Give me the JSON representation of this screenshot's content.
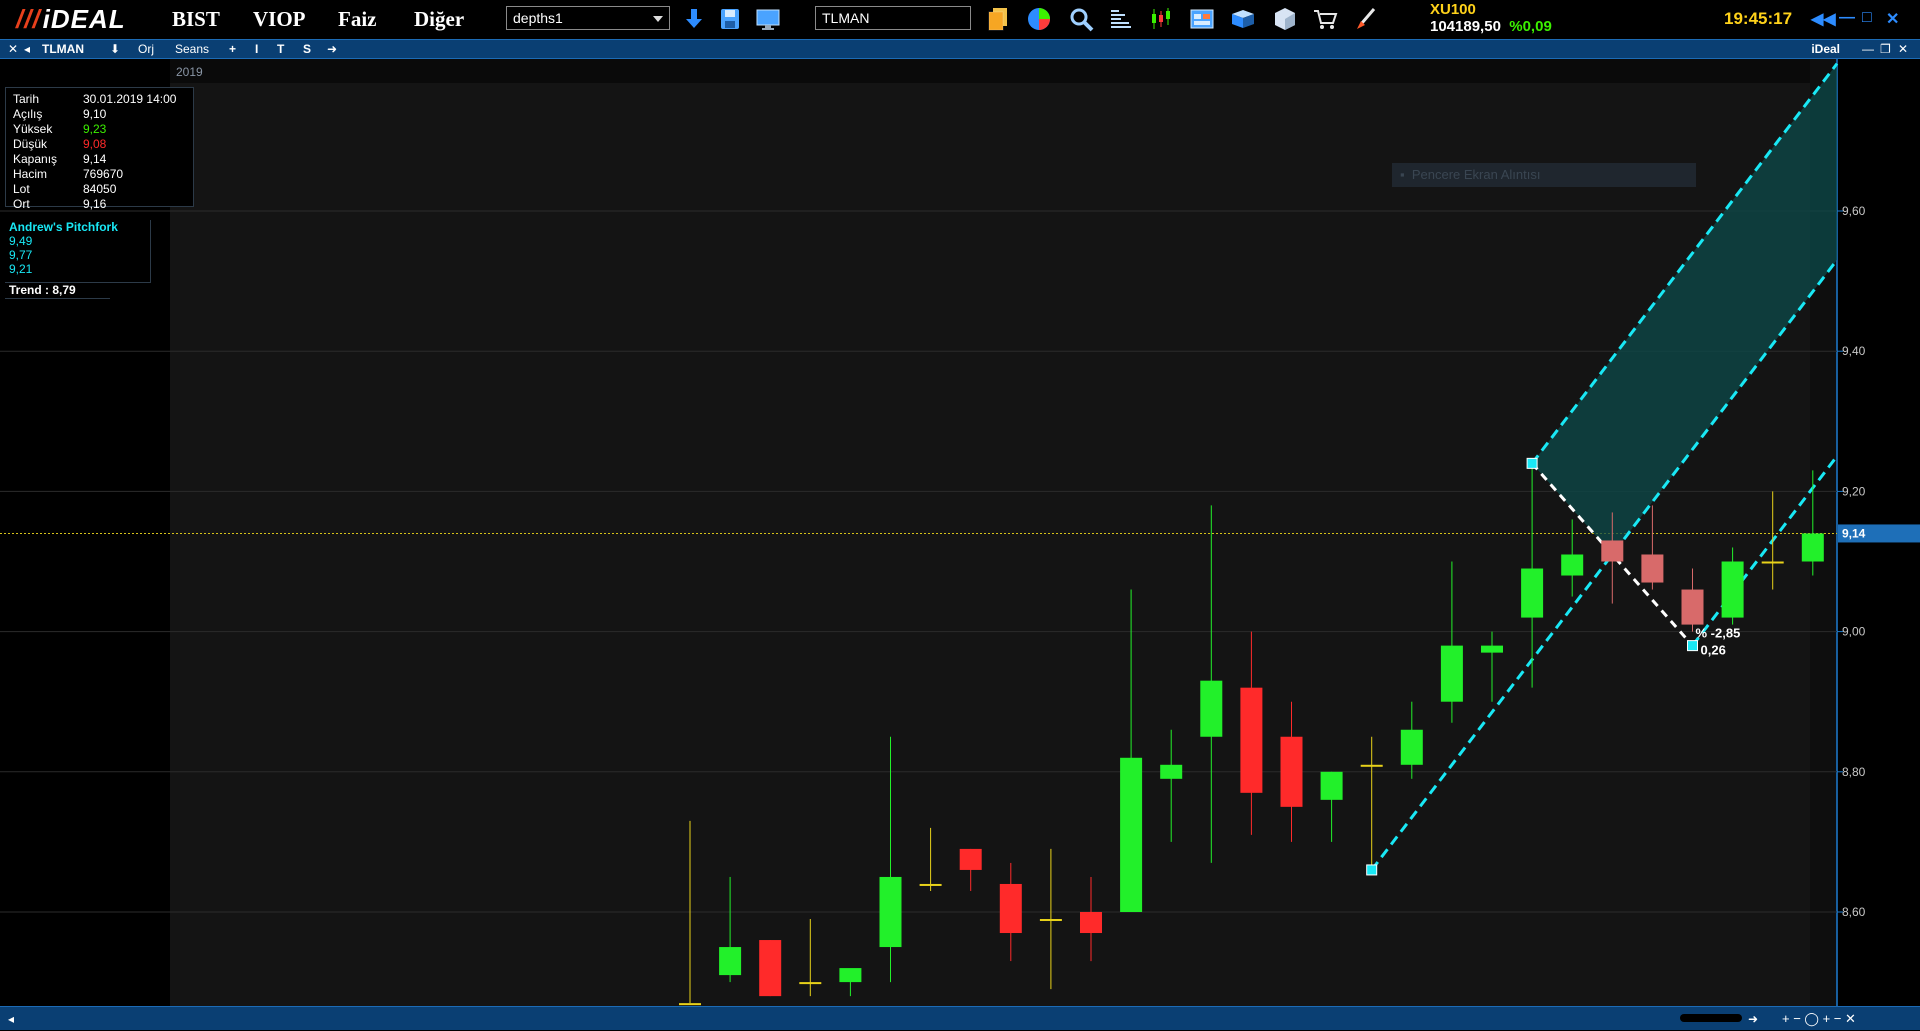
{
  "app": {
    "logo": "iDEAL",
    "menu": [
      "BIST",
      "VIOP",
      "Faiz",
      "Diğer"
    ],
    "layout_combo": "depths1",
    "symbol_input": "TLMAN"
  },
  "ticker": {
    "name": "XU100",
    "value": "104189,50",
    "change": "%0,09"
  },
  "clock": "19:45:17",
  "chart_toolbar": {
    "symbol": "TLMAN",
    "buttons": [
      "Orj",
      "Seans",
      "+",
      "I",
      "T",
      "S"
    ],
    "brand": "iDeal"
  },
  "chart_header": {
    "year_label": "2019"
  },
  "info_panel": {
    "rows": [
      {
        "k": "Tarih",
        "v": "30.01.2019 14:00"
      },
      {
        "k": "Açılış",
        "v": "9,10"
      },
      {
        "k": "Yüksek",
        "v": "9,23"
      },
      {
        "k": "Düşük",
        "v": "9,08"
      },
      {
        "k": "Kapanış",
        "v": "9,14"
      },
      {
        "k": "Hacim",
        "v": "769670"
      },
      {
        "k": "Lot",
        "v": "84050"
      },
      {
        "k": "Ort",
        "v": "9,16"
      }
    ],
    "colors": {
      "Yüksek": "#3cf000",
      "Düşük": "#ff2a2a"
    }
  },
  "pitchfork": {
    "title": "Andrew's Pitchfork",
    "values": [
      "9,49",
      "9,77",
      "9,21"
    ]
  },
  "trend": "Trend  :  8,79",
  "popup_text": "Pencere Ekran Alıntısı",
  "annotations": {
    "pct": "% -2,85",
    "diff": "0,26"
  },
  "price_axis": {
    "current": "9,14"
  },
  "chart_data": {
    "type": "candlestick",
    "ylim": [
      8.47,
      9.78
    ],
    "y_ticks": [
      8.6,
      8.8,
      9.0,
      9.2,
      9.4,
      9.6
    ],
    "y_tick_labels": [
      "8,60",
      "8,80",
      "9,00",
      "9,20",
      "9,40",
      "9,60"
    ],
    "current_price": 9.14,
    "candles": [
      {
        "o": 8.47,
        "h": 8.73,
        "l": 8.47,
        "c": 8.47
      },
      {
        "o": 8.51,
        "h": 8.65,
        "l": 8.5,
        "c": 8.55
      },
      {
        "o": 8.56,
        "h": 8.56,
        "l": 8.48,
        "c": 8.48
      },
      {
        "o": 8.5,
        "h": 8.59,
        "l": 8.48,
        "c": 8.5
      },
      {
        "o": 8.5,
        "h": 8.51,
        "l": 8.48,
        "c": 8.52
      },
      {
        "o": 8.55,
        "h": 8.85,
        "l": 8.5,
        "c": 8.65
      },
      {
        "o": 8.64,
        "h": 8.72,
        "l": 8.63,
        "c": 8.64
      },
      {
        "o": 8.69,
        "h": 8.69,
        "l": 8.63,
        "c": 8.66
      },
      {
        "o": 8.64,
        "h": 8.67,
        "l": 8.53,
        "c": 8.57
      },
      {
        "o": 8.59,
        "h": 8.69,
        "l": 8.49,
        "c": 8.59
      },
      {
        "o": 8.6,
        "h": 8.65,
        "l": 8.53,
        "c": 8.57
      },
      {
        "o": 8.6,
        "h": 9.06,
        "l": 8.6,
        "c": 8.82
      },
      {
        "o": 8.79,
        "h": 8.86,
        "l": 8.7,
        "c": 8.81
      },
      {
        "o": 8.85,
        "h": 9.18,
        "l": 8.67,
        "c": 8.93
      },
      {
        "o": 8.92,
        "h": 9.0,
        "l": 8.71,
        "c": 8.77
      },
      {
        "o": 8.85,
        "h": 8.9,
        "l": 8.7,
        "c": 8.75
      },
      {
        "o": 8.76,
        "h": 8.8,
        "l": 8.7,
        "c": 8.8
      },
      {
        "o": 8.81,
        "h": 8.85,
        "l": 8.66,
        "c": 8.81
      },
      {
        "o": 8.81,
        "h": 8.9,
        "l": 8.79,
        "c": 8.86
      },
      {
        "o": 8.9,
        "h": 9.1,
        "l": 8.87,
        "c": 8.98
      },
      {
        "o": 8.97,
        "h": 9.0,
        "l": 8.9,
        "c": 8.98
      },
      {
        "o": 9.02,
        "h": 9.24,
        "l": 8.92,
        "c": 9.09
      },
      {
        "o": 9.08,
        "h": 9.16,
        "l": 9.05,
        "c": 9.11
      },
      {
        "o": 9.13,
        "h": 9.17,
        "l": 9.04,
        "c": 9.1
      },
      {
        "o": 9.11,
        "h": 9.18,
        "l": 9.06,
        "c": 9.07
      },
      {
        "o": 9.06,
        "h": 9.09,
        "l": 9.0,
        "c": 9.01
      },
      {
        "o": 9.02,
        "h": 9.12,
        "l": 9.01,
        "c": 9.1
      },
      {
        "o": 9.1,
        "h": 9.2,
        "l": 9.06,
        "c": 9.1
      },
      {
        "o": 9.1,
        "h": 9.23,
        "l": 9.08,
        "c": 9.14
      }
    ],
    "pitchfork": {
      "p1": {
        "i": 17,
        "y": 8.66
      },
      "p2": {
        "i": 21,
        "y": 9.24
      },
      "p3": {
        "i": 25,
        "y": 8.98
      }
    }
  }
}
